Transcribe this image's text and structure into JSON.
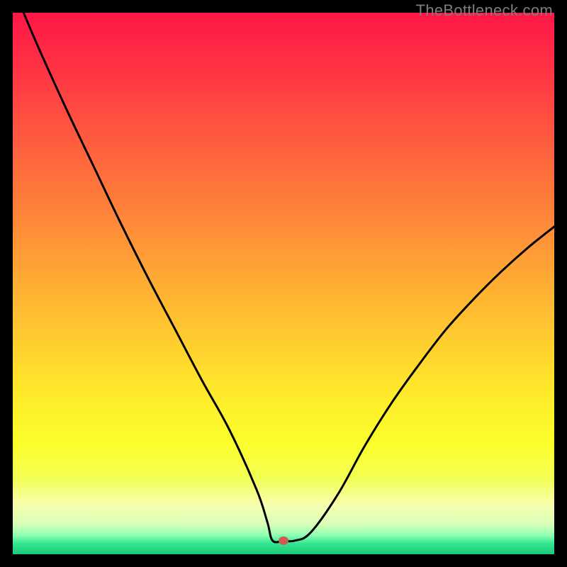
{
  "watermark": "TheBottleneck.com",
  "chart_data": {
    "type": "line",
    "title": "",
    "xlabel": "",
    "ylabel": "",
    "xlim": [
      0,
      100
    ],
    "ylim": [
      0,
      100
    ],
    "grid": false,
    "legend": false,
    "series": [
      {
        "name": "curve",
        "x": [
          2,
          5,
          10,
          15,
          20,
          25,
          30,
          35,
          40,
          45,
          47,
          48,
          50,
          52,
          55,
          60,
          65,
          70,
          75,
          80,
          85,
          90,
          95,
          100
        ],
        "y": [
          100,
          93,
          82,
          71.5,
          61,
          51,
          41.5,
          32,
          23,
          12,
          6,
          2.5,
          2.5,
          2.5,
          4,
          11,
          20,
          28,
          35,
          41.5,
          47,
          52,
          56.5,
          60.5
        ]
      }
    ],
    "marker": {
      "x": 50,
      "y": 2.5,
      "color": "#cf5a52"
    },
    "gradient_bands": [
      {
        "y": 100,
        "color": "#ff1647"
      },
      {
        "y": 90,
        "color": "#ff3244"
      },
      {
        "y": 80,
        "color": "#ff5140"
      },
      {
        "y": 70,
        "color": "#ff6f3c"
      },
      {
        "y": 60,
        "color": "#ff8d38"
      },
      {
        "y": 50,
        "color": "#ffad33"
      },
      {
        "y": 40,
        "color": "#ffcb2f"
      },
      {
        "y": 30,
        "color": "#ffe92b"
      },
      {
        "y": 20,
        "color": "#fbff2c"
      },
      {
        "y": 14,
        "color": "#f4ff55"
      },
      {
        "y": 9,
        "color": "#f6ffb0"
      },
      {
        "y": 5.5,
        "color": "#d8ffb8"
      },
      {
        "y": 3.5,
        "color": "#8dffb0"
      },
      {
        "y": 2.0,
        "color": "#34e691"
      },
      {
        "y": 0,
        "color": "#19c979"
      }
    ]
  }
}
